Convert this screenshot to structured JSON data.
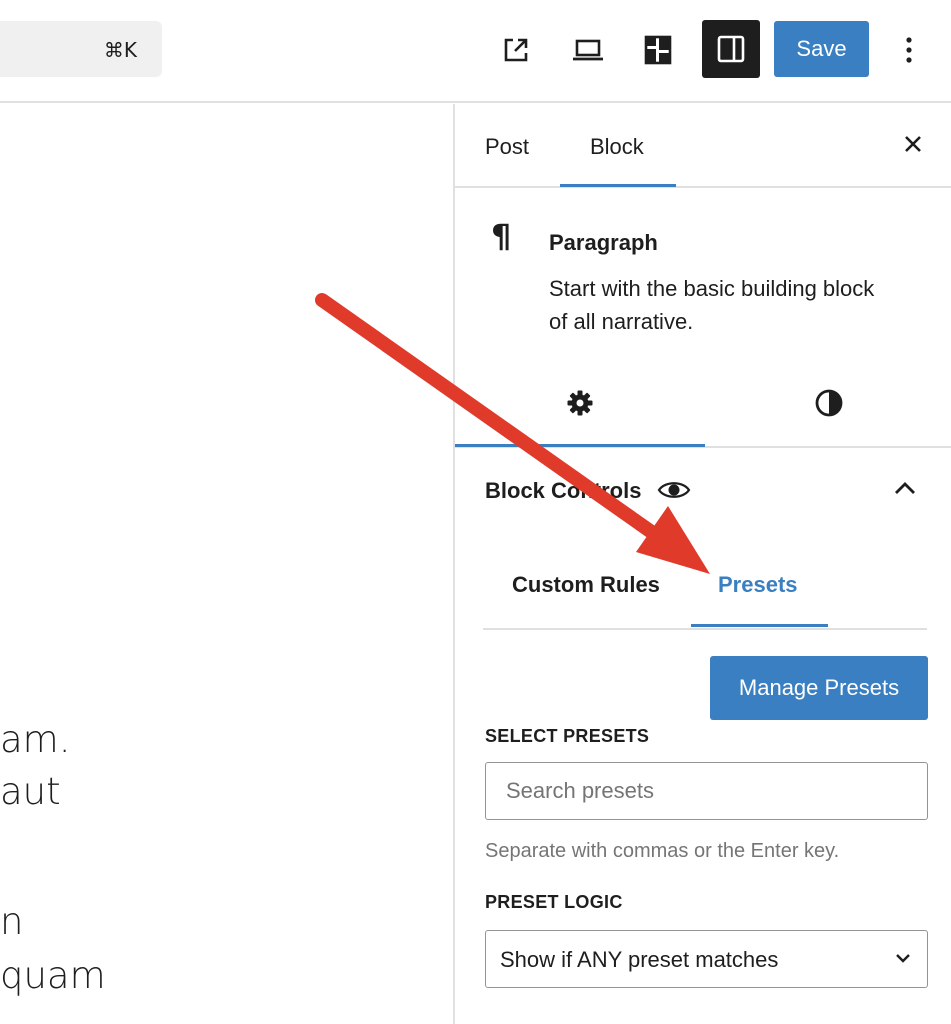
{
  "toolbar": {
    "command_shortcut": "⌘K",
    "save_label": "Save",
    "icons": [
      "external-link-icon",
      "preview-device-icon",
      "styles-icon",
      "settings-sidebar-icon",
      "more-options-icon"
    ]
  },
  "canvas": {
    "text_fragments": [
      "am.",
      "aut",
      "n",
      "quam"
    ]
  },
  "sidebar": {
    "tabs": [
      {
        "label": "Post"
      },
      {
        "label": "Block"
      }
    ],
    "block": {
      "icon": "¶",
      "title": "Paragraph",
      "description": "Start with the basic building block of all narrative."
    },
    "panel": {
      "title": "Block Controls",
      "rule_tabs": [
        {
          "label": "Custom Rules"
        },
        {
          "label": "Presets"
        }
      ],
      "manage_button": "Manage Presets",
      "select_presets_label": "SELECT PRESETS",
      "search_placeholder": "Search presets",
      "help_text": "Separate with commas or the Enter key.",
      "preset_logic_label": "PRESET LOGIC",
      "preset_logic_value": "Show if ANY preset matches"
    }
  },
  "colors": {
    "accent": "#3a7fc1",
    "dark": "#1e1e1e",
    "annotation": "#e03a2b"
  }
}
